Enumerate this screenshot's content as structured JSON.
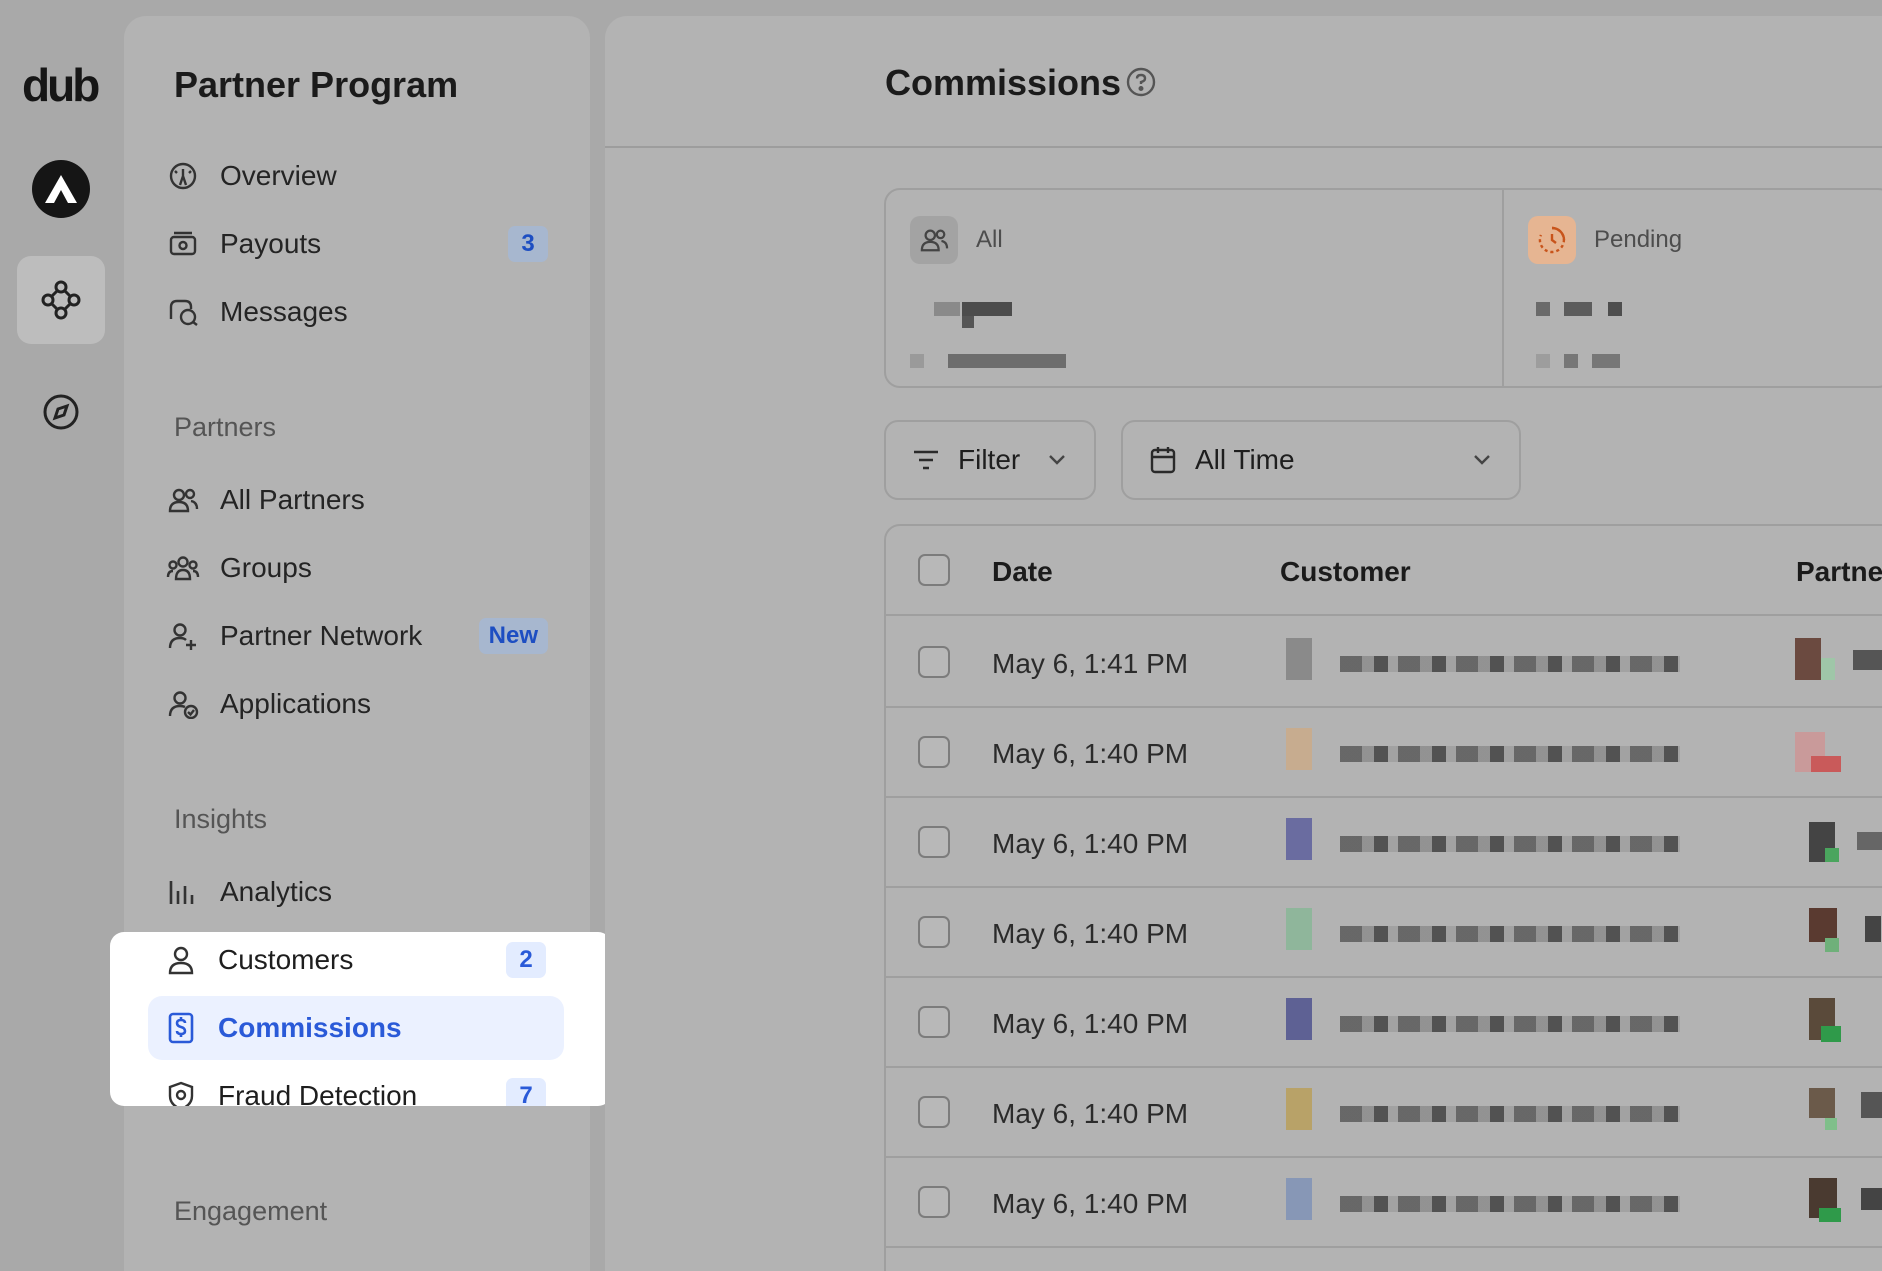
{
  "app": {
    "logo": "dub"
  },
  "sidebar": {
    "title": "Partner Program",
    "items": [
      {
        "label": "Overview",
        "icon": "gauge-icon"
      },
      {
        "label": "Payouts",
        "icon": "money-icon",
        "badge": "3"
      },
      {
        "label": "Messages",
        "icon": "chat-icon"
      }
    ],
    "sections": [
      {
        "label": "Partners",
        "items": [
          {
            "label": "All Partners",
            "icon": "users-icon"
          },
          {
            "label": "Groups",
            "icon": "groups-icon"
          },
          {
            "label": "Partner Network",
            "icon": "user-plus-icon",
            "badge": "New"
          },
          {
            "label": "Applications",
            "icon": "user-check-icon"
          }
        ]
      },
      {
        "label": "Insights",
        "items": [
          {
            "label": "Analytics",
            "icon": "bar-chart-icon"
          },
          {
            "label": "Customers",
            "icon": "user-icon",
            "badge": "2"
          },
          {
            "label": "Commissions",
            "icon": "invoice-dollar-icon",
            "active": true
          },
          {
            "label": "Fraud Detection",
            "icon": "shield-icon",
            "badge": "7"
          }
        ]
      },
      {
        "label": "Engagement",
        "items": []
      }
    ]
  },
  "main": {
    "title": "Commissions",
    "stats": [
      {
        "label": "All"
      },
      {
        "label": "Pending"
      }
    ],
    "filter_label": "Filter",
    "date_range": "All Time",
    "table": {
      "columns": [
        "Date",
        "Customer",
        "Partne"
      ],
      "rows": [
        {
          "date": "May 6, 1:41 PM"
        },
        {
          "date": "May 6, 1:40 PM"
        },
        {
          "date": "May 6, 1:40 PM"
        },
        {
          "date": "May 6, 1:40 PM"
        },
        {
          "date": "May 6, 1:40 PM"
        },
        {
          "date": "May 6, 1:40 PM"
        },
        {
          "date": "May 6, 1:40 PM"
        }
      ]
    }
  },
  "colors": {
    "accent": "#2a5ad8",
    "active_bg": "#ebf1ff",
    "pending_icon_bg": "#e6b592",
    "pending_icon": "#c8541b"
  }
}
